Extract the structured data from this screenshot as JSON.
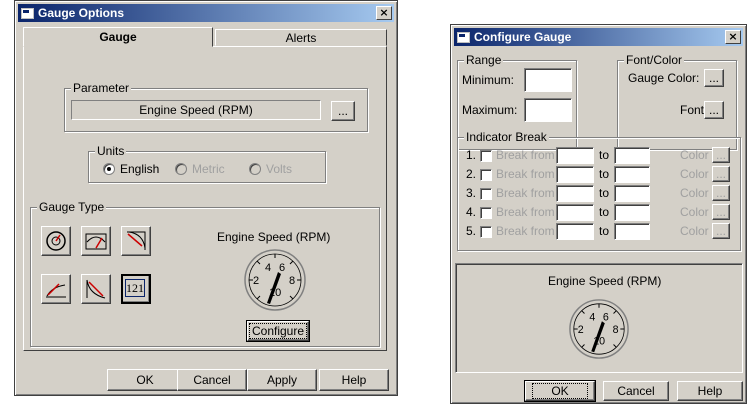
{
  "gauge_options": {
    "title": "Gauge Options",
    "close_glyph": "×",
    "tabs": [
      "Gauge",
      "Alerts"
    ],
    "parameter": {
      "label": "Parameter",
      "value": "Engine Speed (RPM)",
      "browse_label": "..."
    },
    "units": {
      "label": "Units",
      "options": [
        "English",
        "Metric",
        "Volts"
      ],
      "selected": "English"
    },
    "gauge_type": {
      "label": "Gauge Type",
      "preview_title": "Engine Speed (RPM)",
      "dial_numbers": [
        "2",
        "4",
        "6",
        "8",
        "10"
      ],
      "configure_label": "Configure",
      "type_icons": [
        "round-dial-gauge-icon",
        "arc-gauge-icon",
        "corner-sweep-gauge-icon",
        "curve-gauge-icon",
        "diagonal-line-gauge-icon",
        "digital-readout-icon"
      ],
      "digital_text": "121"
    },
    "buttons": [
      "OK",
      "Cancel",
      "Apply",
      "Help"
    ]
  },
  "configure_gauge": {
    "title": "Configure Gauge",
    "close_glyph": "×",
    "range": {
      "label": "Range",
      "minimum_label": "Minimum:",
      "maximum_label": "Maximum:",
      "minimum_value": "",
      "maximum_value": ""
    },
    "font_color": {
      "label": "Font/Color",
      "gauge_color_label": "Gauge Color:",
      "font_label": "Font:",
      "browse_label": "..."
    },
    "indicator_break": {
      "label": "Indicator Break",
      "rows": [
        {
          "num": "1.",
          "break_from": "Break from",
          "to": "to",
          "color": "Color"
        },
        {
          "num": "2.",
          "break_from": "Break from",
          "to": "to",
          "color": "Color"
        },
        {
          "num": "3.",
          "break_from": "Break from",
          "to": "to",
          "color": "Color"
        },
        {
          "num": "4.",
          "break_from": "Break from",
          "to": "to",
          "color": "Color"
        },
        {
          "num": "5.",
          "break_from": "Break from",
          "to": "to",
          "color": "Color"
        }
      ],
      "browse_label": "..."
    },
    "preview_title": "Engine Speed (RPM)",
    "dial_numbers": [
      "2",
      "4",
      "6",
      "8",
      "10"
    ],
    "buttons": [
      "OK",
      "Cancel",
      "Help"
    ]
  },
  "colors": {
    "dialog_face": "#d4d0c8",
    "title_active": "#0a246a",
    "gauge_needle": "#000000",
    "icon_line_red": "#cc0000"
  }
}
